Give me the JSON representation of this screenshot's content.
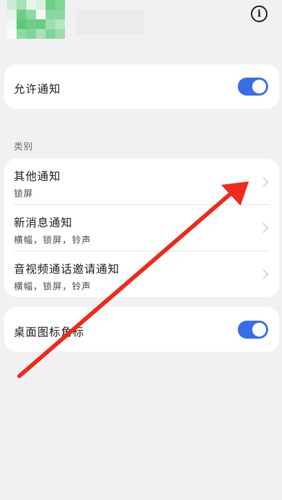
{
  "header": {
    "info_icon": "info-icon",
    "info_glyph": "i"
  },
  "allow_notifications": {
    "label": "允许通知",
    "enabled": true
  },
  "categories": {
    "section_label": "类别",
    "items": [
      {
        "title": "其他通知",
        "subtitle": "锁屏"
      },
      {
        "title": "新消息通知",
        "subtitle": "横幅，锁屏，铃声"
      },
      {
        "title": "音视频通话邀请通知",
        "subtitle": "横幅，锁屏，铃声"
      }
    ]
  },
  "badge": {
    "label": "桌面图标角标",
    "enabled": true
  },
  "colors": {
    "toggle_on": "#3a6ce6",
    "annotation_arrow": "#ee2a1b",
    "background": "#f1f1f3"
  }
}
